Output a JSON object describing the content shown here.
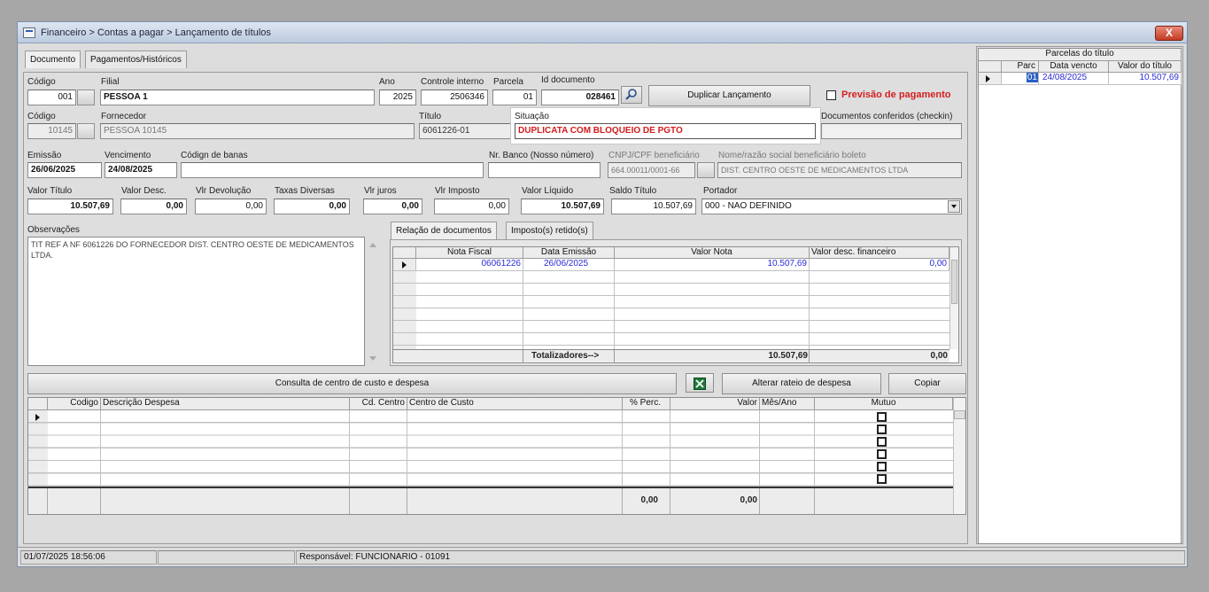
{
  "window": {
    "title": "Financeiro > Contas a pagar > Lançamento de títulos",
    "close_label": "X"
  },
  "tabs": [
    "Documento",
    "Pagamentos/Históricos"
  ],
  "header": {
    "codigo_label": "Código",
    "codigo": "001",
    "filial_label": "Filial",
    "filial": "PESSOA 1",
    "ano_label": "Ano",
    "ano": "2025",
    "controle_label": "Controle interno",
    "controle": "2506346",
    "parcela_label": "Parcela",
    "parcela": "01",
    "id_doc_label": "Id documento",
    "id_doc": "028461",
    "duplicar_label": "Duplicar Lançamento",
    "previsao_label": "Previsão de pagamento",
    "fornecedor_codigo_label": "Código",
    "fornecedor_codigo": "10145",
    "fornecedor_label": "Fornecedor",
    "fornecedor": "PESSOA 10145",
    "titulo_label": "Título",
    "titulo": "6061226-01",
    "situacao_label": "Situação",
    "situacao": "DUPLICATA COM BLOQUEIO DE PGTO",
    "checkin_label": "Documentos conferidos (checkin)",
    "emissao_label": "Emissão",
    "emissao": "26/06/2025",
    "vencimento_label": "Vencimento",
    "vencimento": "24/08/2025",
    "codbarras_label": "Códign de banas",
    "nrbanco_label": "Nr. Banco (Nosso número)",
    "cnpj_label": "CNPJ/CPF beneficiário",
    "cnpj": "664.00011/0001-66",
    "nome_benef_label": "Nome/razão social beneficiário boleto",
    "nome_benef": "DIST. CENTRO OESTE DE MEDICAMENTOS LTDA"
  },
  "valores": {
    "valor_titulo_label": "Valor Título",
    "valor_titulo": "10.507,69",
    "valor_desc_label": "Valor Desc.",
    "valor_desc": "0,00",
    "vlr_devolucao_label": "Vlr Devolução",
    "vlr_devolucao": "0,00",
    "taxas_label": "Taxas Diversas",
    "taxas": "0,00",
    "vlr_juros_label": "Vlr juros",
    "vlr_juros": "0,00",
    "vlr_imposto_label": "Vlr Imposto",
    "vlr_imposto": "0,00",
    "valor_liquido_label": "Valor Líquido",
    "valor_liquido": "10.507,69",
    "saldo_label": "Saldo Título",
    "saldo": "10.507,69",
    "portador_label": "Portador",
    "portador": "000 - NAO DEFINIDO"
  },
  "observacoes": {
    "label": "Observações",
    "text": "TIT REF A NF 6061226 DO FORNECEDOR DIST. CENTRO OESTE DE MEDICAMENTOS LTDA."
  },
  "doc_tabs": [
    "Relação de documentos",
    "Imposto(s) retido(s)"
  ],
  "docs_grid": {
    "headers": [
      "Nota Fiscal",
      "Data Emissão",
      "Valor Nota",
      "Valor desc. financeiro"
    ],
    "rows": [
      [
        "06061226",
        "26/06/2025",
        "10.507,69",
        "0,00"
      ]
    ],
    "total_label": "Totalizadores-->",
    "total_valor": "10.507,69",
    "total_desc": "0,00"
  },
  "centro_custo": {
    "consulta_label": "Consulta de centro de custo e despesa",
    "alterar_label": "Alterar rateio de despesa",
    "copiar_label": "Copiar",
    "headers": [
      "Codigo",
      "Descrição Despesa",
      "Cd. Centro",
      "Centro de Custo",
      "% Perc.",
      "Valor",
      "Mês/Ano",
      "Mutuo"
    ],
    "total_perc": "0,00",
    "total_valor": "0,00"
  },
  "parcelas": {
    "title": "Parcelas do título",
    "headers": [
      "Parc",
      "Data vencto",
      "Valor do título"
    ],
    "rows": [
      [
        "01",
        "24/08/2025",
        "10.507,69"
      ]
    ]
  },
  "status_bar": {
    "datetime": "01/07/2025 18:56:06",
    "responsavel": "Responsável: FUNCIONARIO - 01091"
  }
}
